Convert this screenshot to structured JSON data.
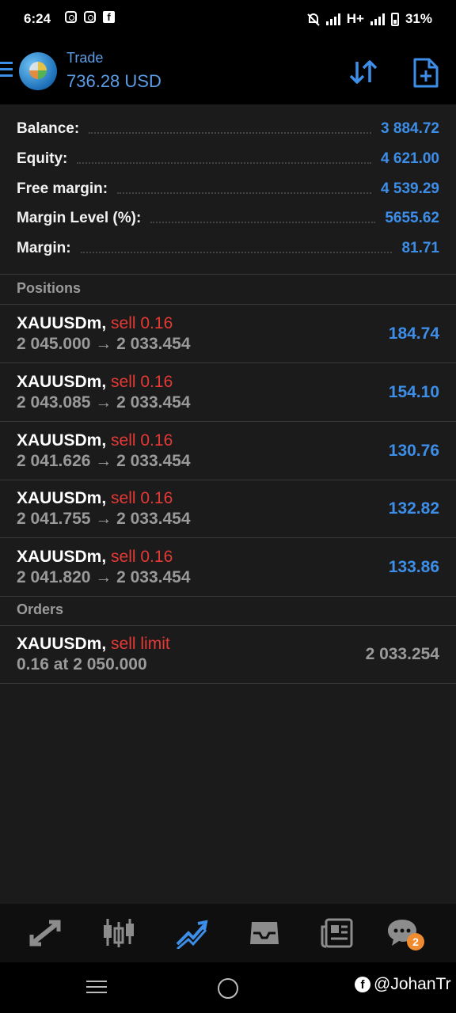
{
  "status_bar": {
    "time": "6:24",
    "network": "H+",
    "battery": "31%"
  },
  "header": {
    "title": "Trade",
    "balance": "736.28 USD"
  },
  "summary": [
    {
      "label": "Balance:",
      "value": "3 884.72"
    },
    {
      "label": "Equity:",
      "value": "4 621.00"
    },
    {
      "label": "Free margin:",
      "value": "4 539.29"
    },
    {
      "label": "Margin Level (%):",
      "value": "5655.62"
    },
    {
      "label": "Margin:",
      "value": "81.71"
    }
  ],
  "positions_label": "Positions",
  "positions": [
    {
      "symbol": "XAUUSDm,",
      "side": "sell 0.16",
      "prices": "2 045.000 → 2 033.454",
      "profit": "184.74"
    },
    {
      "symbol": "XAUUSDm,",
      "side": "sell 0.16",
      "prices": "2 043.085 → 2 033.454",
      "profit": "154.10"
    },
    {
      "symbol": "XAUUSDm,",
      "side": "sell 0.16",
      "prices": "2 041.626 → 2 033.454",
      "profit": "130.76"
    },
    {
      "symbol": "XAUUSDm,",
      "side": "sell 0.16",
      "prices": "2 041.755 → 2 033.454",
      "profit": "132.82"
    },
    {
      "symbol": "XAUUSDm,",
      "side": "sell 0.16",
      "prices": "2 041.820 → 2 033.454",
      "profit": "133.86"
    }
  ],
  "orders_label": "Orders",
  "orders": [
    {
      "symbol": "XAUUSDm,",
      "side": "sell limit",
      "details": "0.16 at 2 050.000",
      "price": "2 033.254"
    }
  ],
  "bottom_nav": {
    "items": [
      "quotes-icon",
      "chart-icon",
      "trade-icon",
      "history-icon",
      "news-icon",
      "chat-icon"
    ],
    "active": "trade-icon",
    "chat_badge": "2"
  },
  "watermark": "@JohanTr",
  "colors": {
    "accent": "#3d8ee8",
    "sell": "#e53935",
    "badge": "#f08b2f"
  }
}
